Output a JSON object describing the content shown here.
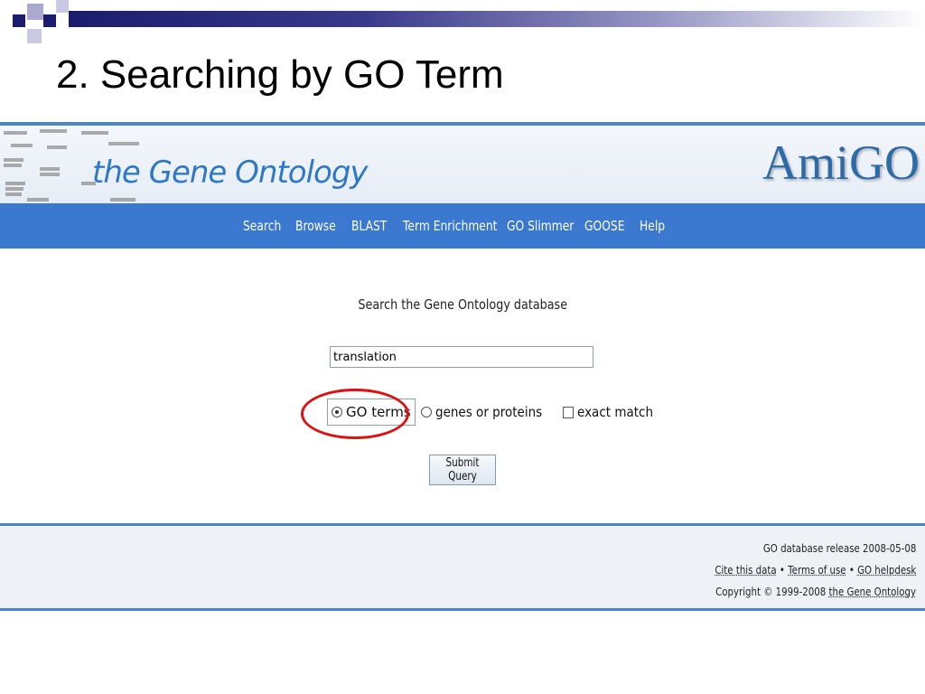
{
  "slide": {
    "title": "2. Searching by GO Term"
  },
  "banner": {
    "site_name": "the Gene Ontology",
    "logo": "AmiGO"
  },
  "nav": {
    "items": [
      {
        "label": "Search"
      },
      {
        "label": "Browse"
      },
      {
        "label": "BLAST"
      },
      {
        "label": "Term Enrichment"
      },
      {
        "label": "GO Slimmer"
      },
      {
        "label": "GOOSE"
      },
      {
        "label": "Help"
      }
    ]
  },
  "search": {
    "heading": "Search the Gene Ontology database",
    "query_value": "translation",
    "options": {
      "go_terms_label": "GO terms",
      "go_terms_selected": true,
      "genes_label": "genes or proteins",
      "genes_selected": false,
      "exact_match_label": "exact match",
      "exact_match_checked": false
    },
    "submit_label": "Submit Query"
  },
  "footer": {
    "release": "GO database release 2008-05-08",
    "links": {
      "cite": "Cite this data",
      "terms": "Terms of use",
      "helpdesk": "GO helpdesk"
    },
    "copyright_prefix": "Copyright © 1999-2008",
    "copyright_link": "the Gene Ontology",
    "bullet": "•"
  },
  "colors": {
    "nav_bg": "#3b78d0",
    "accent_rule": "#4a86c9",
    "annotation": "#e01010",
    "slide_bar": "#1c1c6e"
  }
}
